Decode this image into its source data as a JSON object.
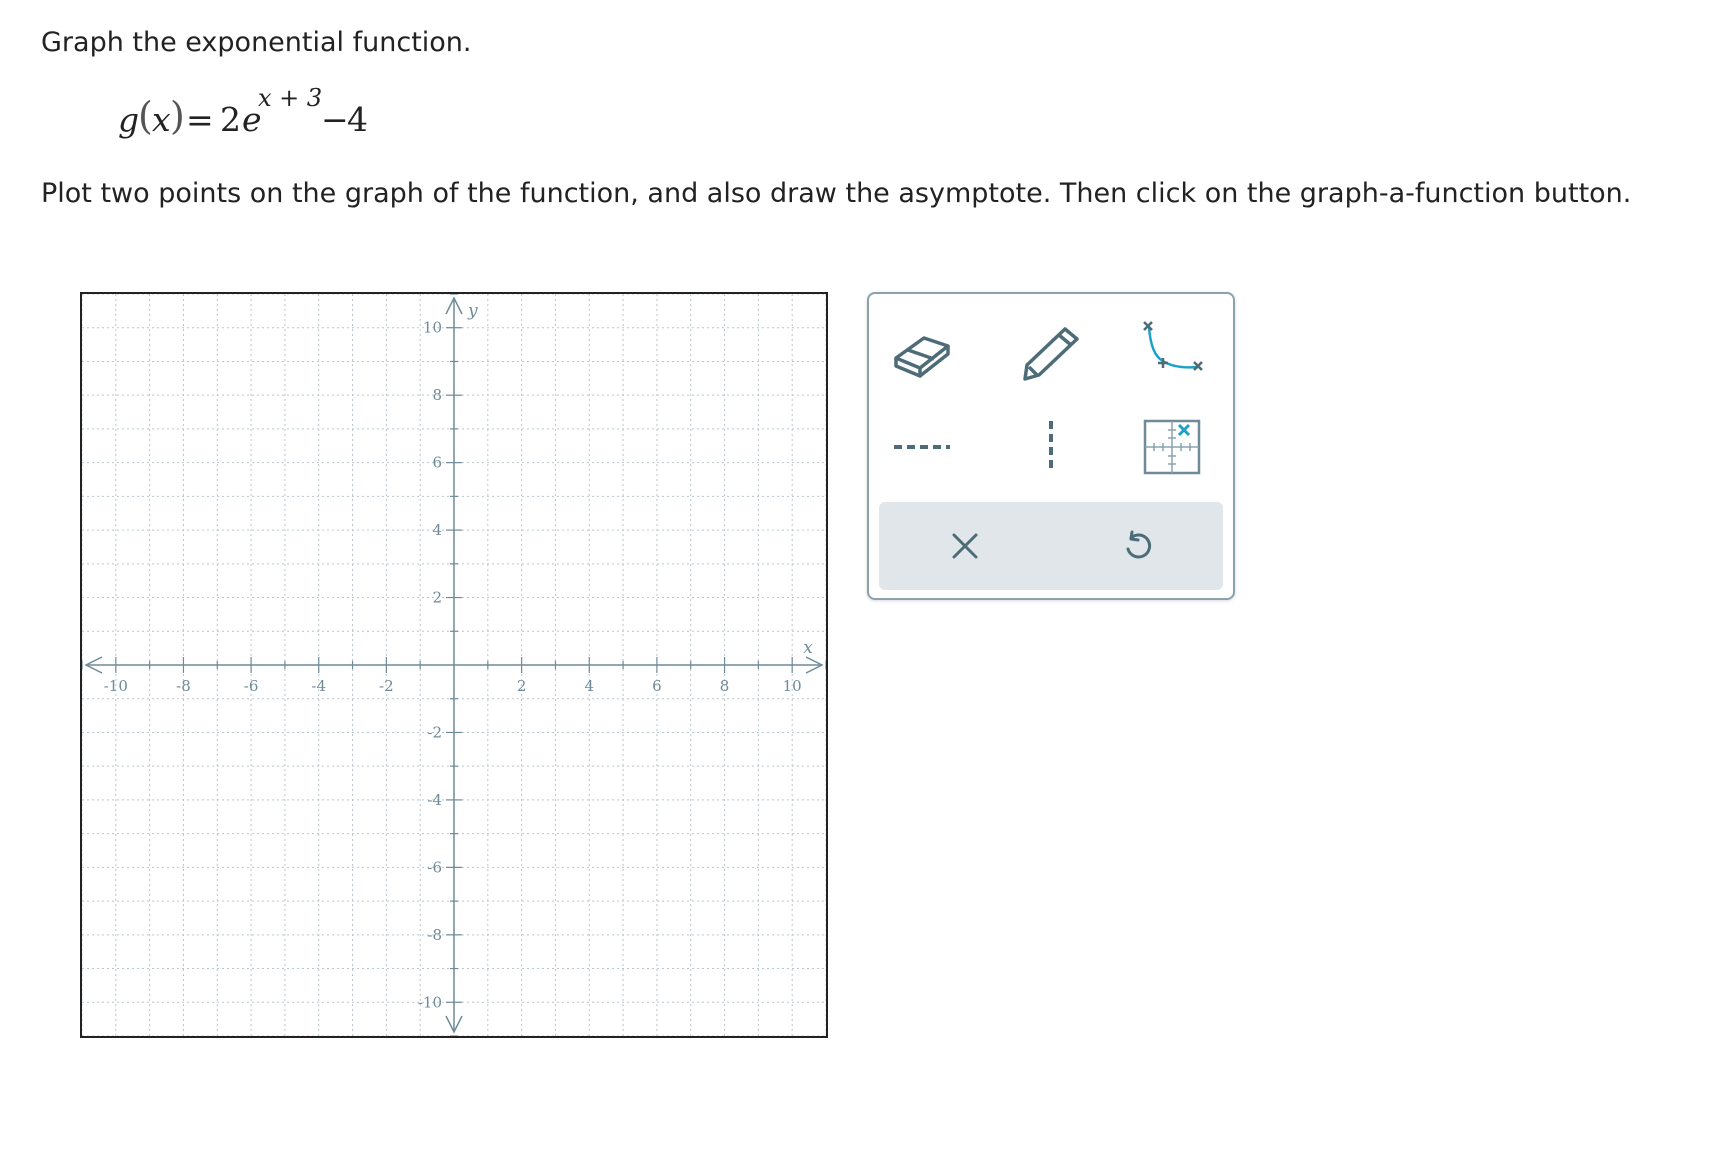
{
  "prompt": {
    "title": "Graph the exponential function.",
    "instructions": "Plot two points on the graph of the function, and also draw the asymptote. Then click on the graph-a-function button."
  },
  "equation": {
    "func_name": "g",
    "open_paren": "(",
    "variable": "x",
    "close_paren": ")",
    "equals": "=",
    "coefficient": "2",
    "base": "e",
    "exponent": "x + 3",
    "minus": "−",
    "constant": "4"
  },
  "graph": {
    "x_axis_label": "x",
    "y_axis_label": "y",
    "x_range": [
      -11,
      11
    ],
    "y_range": [
      -11,
      11
    ],
    "minor_grid_step": 1,
    "x_tick_labels": [
      "-10",
      "-8",
      "-6",
      "-4",
      "-2",
      "2",
      "4",
      "6",
      "8",
      "10"
    ],
    "x_tick_values": [
      -10,
      -8,
      -6,
      -4,
      -2,
      2,
      4,
      6,
      8,
      10
    ],
    "y_tick_labels": [
      "10",
      "8",
      "6",
      "4",
      "2",
      "-2",
      "-4",
      "-6",
      "-8",
      "-10"
    ],
    "y_tick_values": [
      10,
      8,
      6,
      4,
      2,
      -2,
      -4,
      -6,
      -8,
      -10
    ],
    "grid_style": "dotted",
    "colors": {
      "axis": "#6f8a99",
      "grid": "#b9c6cd",
      "label": "#6f8a99"
    }
  },
  "toolbox": {
    "tools": [
      {
        "name": "eraser-tool",
        "icon": "eraser-icon"
      },
      {
        "name": "pencil-tool",
        "icon": "pencil-icon"
      },
      {
        "name": "graph-a-function-tool",
        "icon": "graph-a-function-icon"
      },
      {
        "name": "horizontal-asymptote-tool",
        "icon": "dashed-horizontal-line-icon"
      },
      {
        "name": "vertical-asymptote-tool",
        "icon": "dashed-vertical-line-icon"
      },
      {
        "name": "no-solution-tool",
        "icon": "no-solution-grid-icon"
      }
    ],
    "actions": [
      {
        "name": "clear-button",
        "icon": "close-icon"
      },
      {
        "name": "undo-button",
        "icon": "undo-icon"
      }
    ],
    "colors": {
      "icon": "#4d6c78",
      "accent": "#1ea1c9",
      "action_bg": "#e0e6e9",
      "border": "#8aa2ad"
    }
  }
}
